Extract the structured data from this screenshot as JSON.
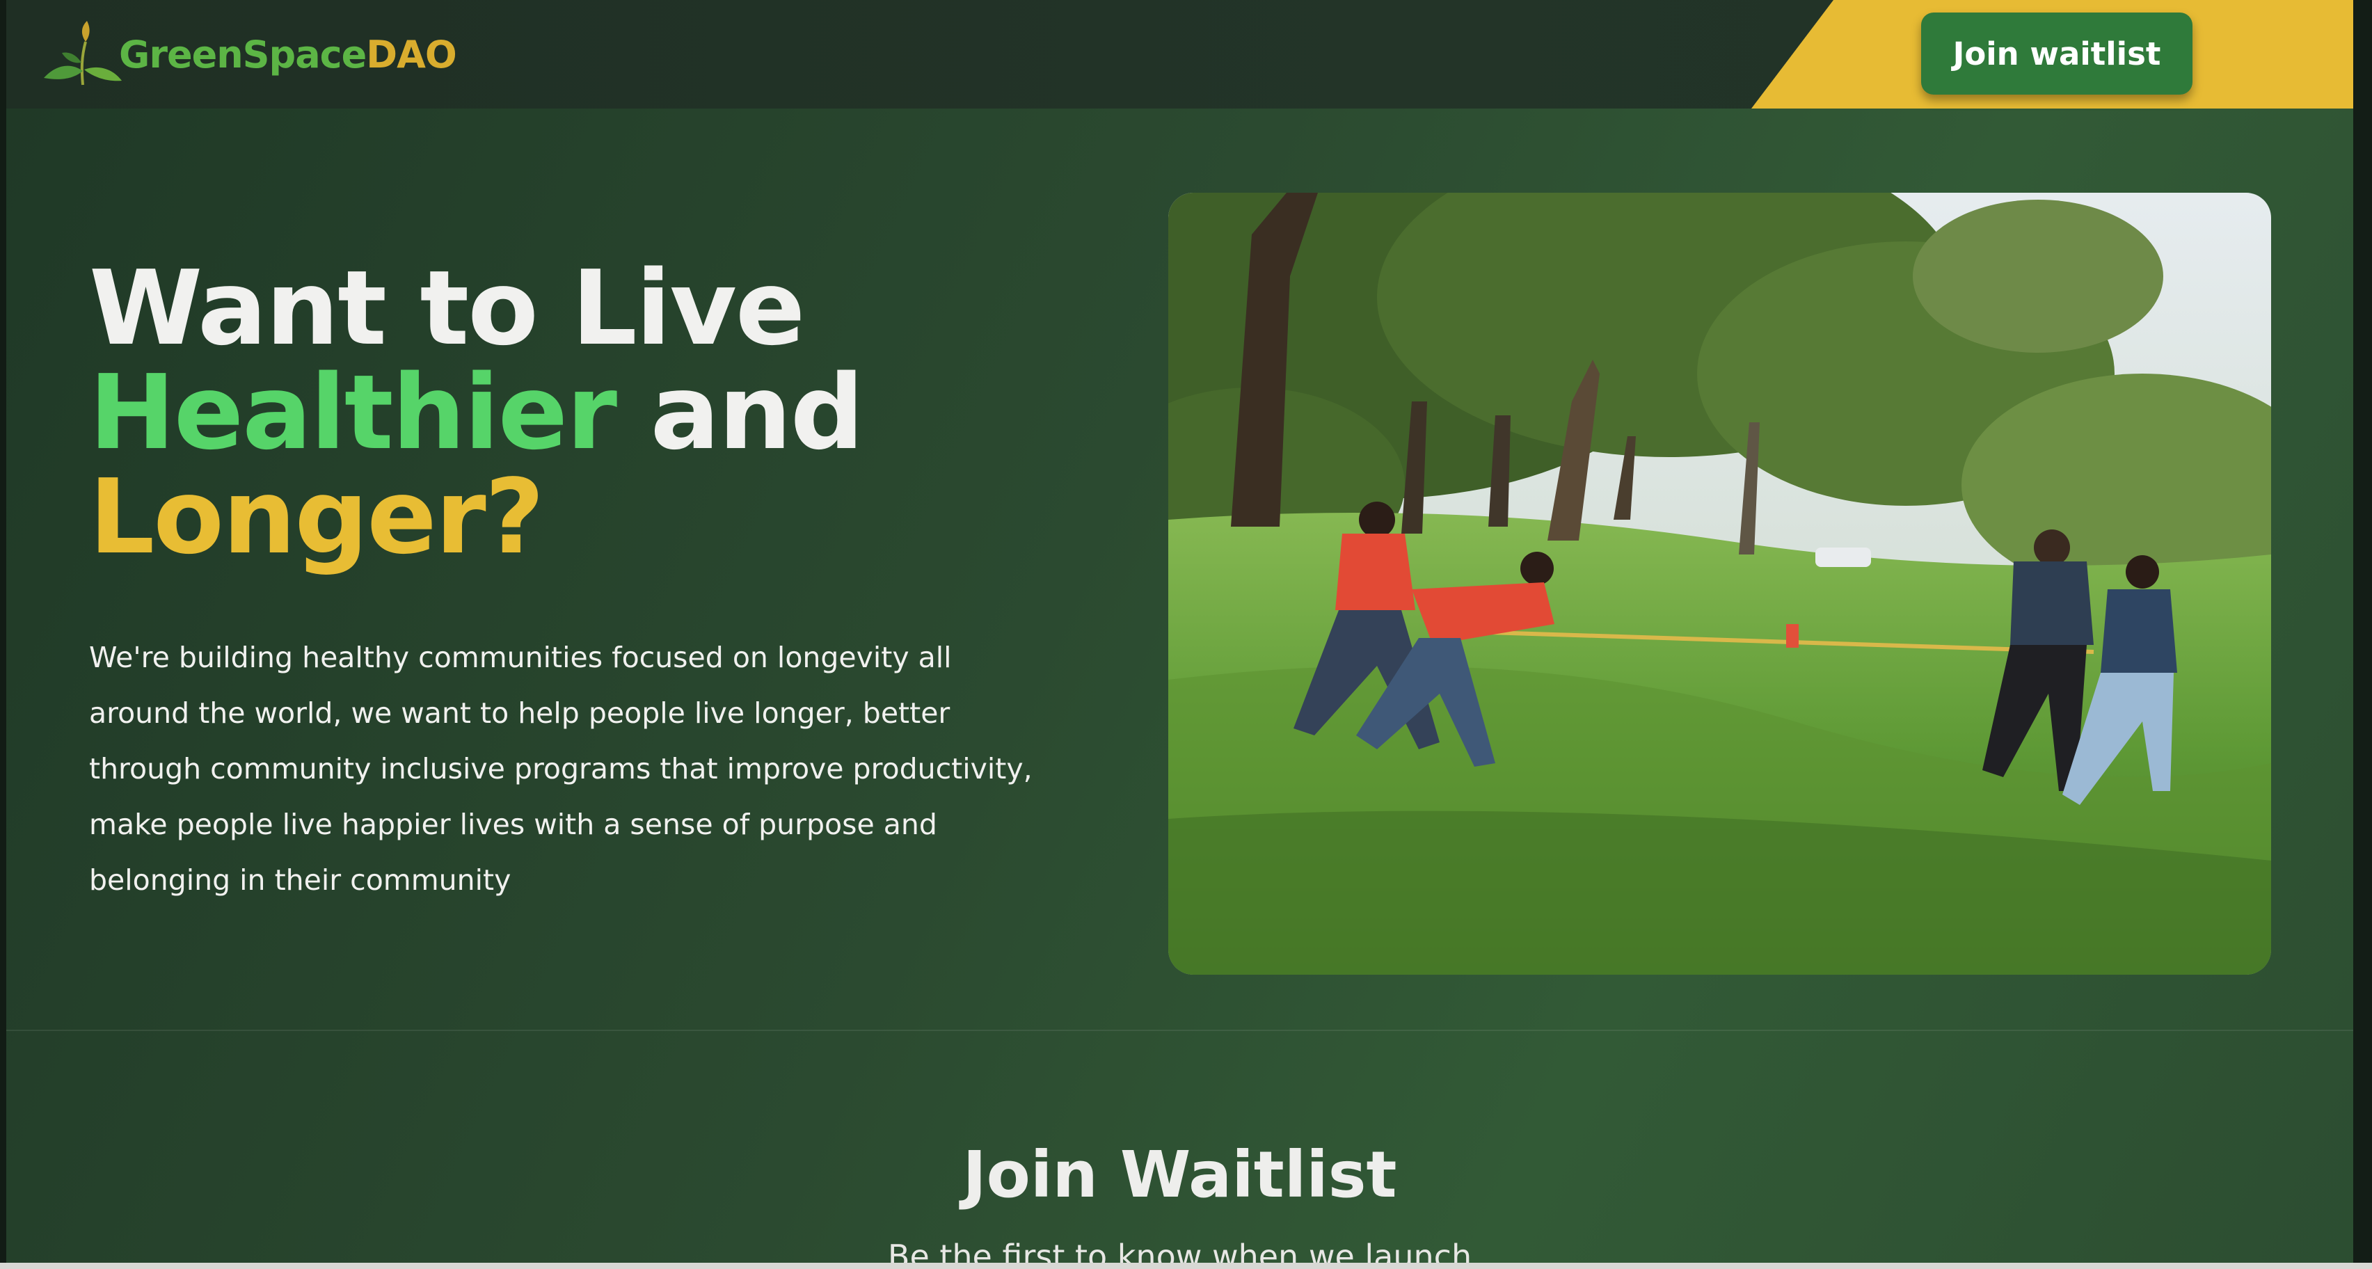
{
  "header": {
    "brand": {
      "part1": "GreenSpace",
      "part2": "DAO",
      "icon": "leaf-sprout-icon"
    },
    "cta_label": "Join waitlist"
  },
  "hero": {
    "title_line1": "Want to Live",
    "title_word_green": "Healthier",
    "title_word_and": "and",
    "title_line3": "Longer?",
    "description": "We're building healthy communities focused on longevity all around the world, we want to help people live longer, better through community inclusive programs that improve productivity, make people live happier lives with a sense of purpose and belonging in their community",
    "image": "people playing tug of war on grass in a park"
  },
  "waitlist": {
    "title": "Join Waitlist",
    "subtitle": "Be the first to know when we launch"
  },
  "colors": {
    "accent_green": "#56d469",
    "accent_gold": "#e8bd34",
    "button_green": "#2f7a3a",
    "background": "#2b4a30"
  }
}
